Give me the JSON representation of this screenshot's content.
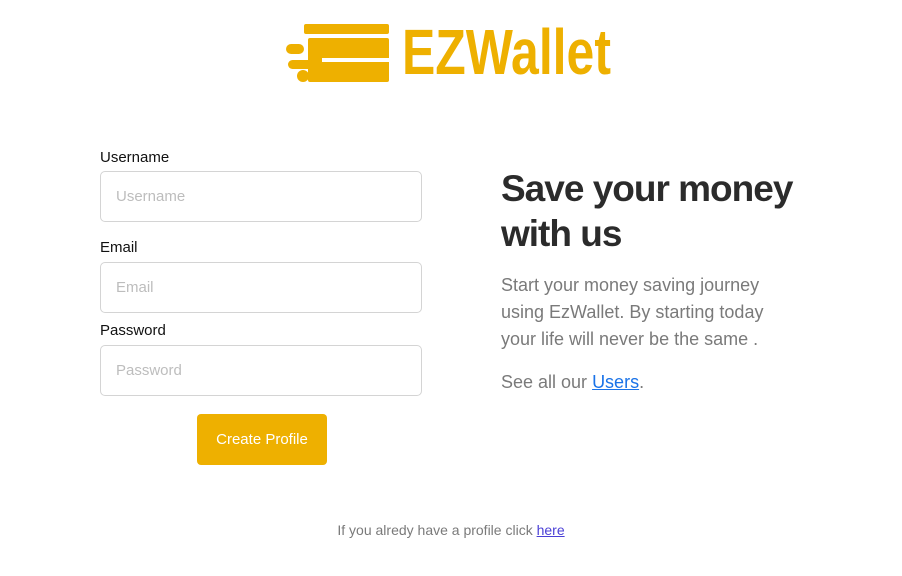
{
  "brand": {
    "name": "EZWallet",
    "color": "#eeb000",
    "icon": "wallet-card-icon"
  },
  "form": {
    "username": {
      "label": "Username",
      "placeholder": "Username"
    },
    "email": {
      "label": "Email",
      "placeholder": "Email"
    },
    "password": {
      "label": "Password",
      "placeholder": "Password"
    },
    "submit_label": "Create Profile"
  },
  "promo": {
    "headline": "Save your money with us",
    "description": "Start your money saving journey using EzWallet. By starting today your life will never be the same .",
    "see_all_prefix": "See all our ",
    "see_all_link": "Users",
    "see_all_suffix": "."
  },
  "footer": {
    "prefix": "If you alredy have a profile click ",
    "link": "here"
  },
  "colors": {
    "accent": "#eeb000",
    "link": "#1a73e8",
    "footer_link": "#4a3fd6"
  }
}
